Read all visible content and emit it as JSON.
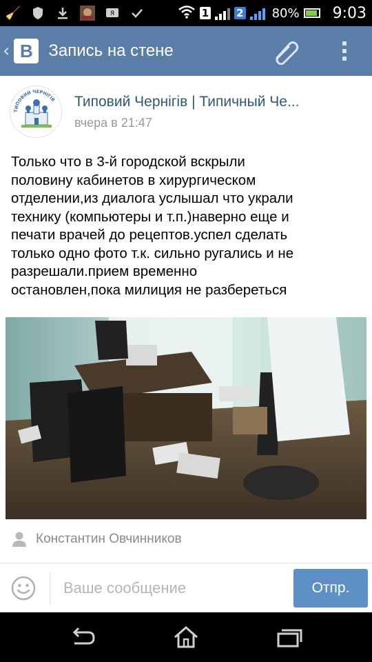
{
  "status_bar": {
    "sim1": "1",
    "sim2": "2",
    "battery": "80%",
    "time": "9:03"
  },
  "header": {
    "title": "Запись на стене",
    "logo": "В"
  },
  "post": {
    "author": "Типовий Чернігів | Типичный Че...",
    "time": "вчера в 21:47",
    "text_lines": [
      "Только что в 3-й городской вскрыли",
      "половину кабинетов в хирургическом",
      "отделении,из диалога услышал что украли",
      "технику (компьютеры и т.п.)наверно еще и",
      "печати врачей до рецептов.успел сделать",
      "только одно фото т.к. сильно ругались и не",
      "разрешали.прием временно",
      "остановлен,пока милиция не разбереться"
    ],
    "signer": "Константин Овчинников",
    "avatar_text": "ТИПОВИЙ ЧЕРНІГІВ"
  },
  "composer": {
    "placeholder": "Ваше сообщение",
    "send_label": "Отпр."
  },
  "colors": {
    "header_bg": "#5a7ea8",
    "send_bg": "#5f8fc7",
    "author": "#2b587a"
  }
}
